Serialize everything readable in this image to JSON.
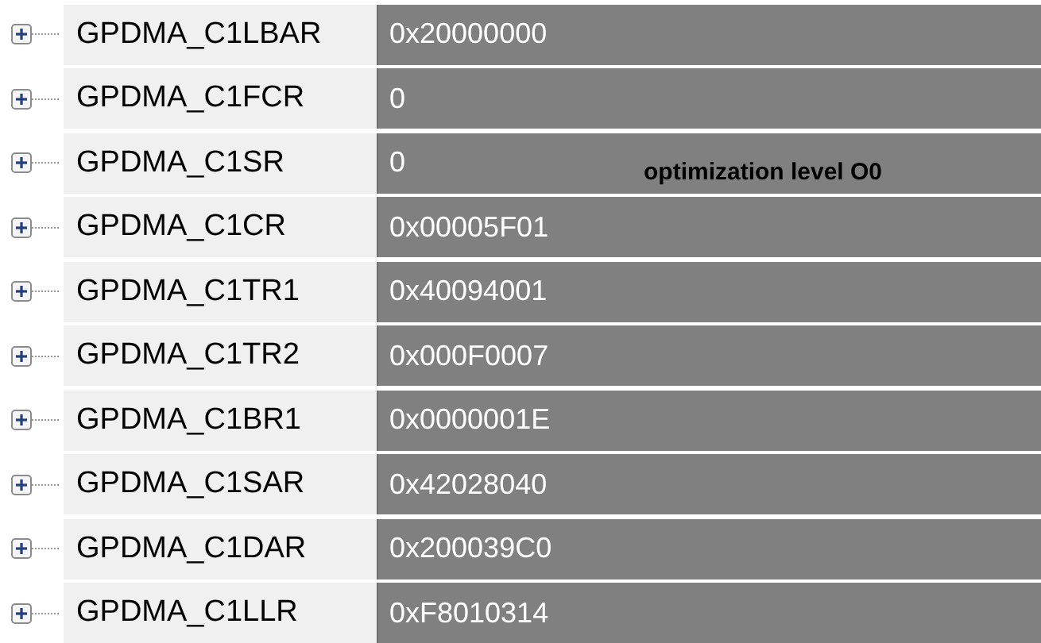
{
  "registers": [
    {
      "name": "GPDMA_C1LBAR",
      "value": "0x20000000",
      "expanded": false
    },
    {
      "name": "GPDMA_C1FCR",
      "value": "0",
      "expanded": false
    },
    {
      "name": "GPDMA_C1SR",
      "value": "0",
      "expanded": false
    },
    {
      "name": "GPDMA_C1CR",
      "value": "0x00005F01",
      "expanded": false
    },
    {
      "name": "GPDMA_C1TR1",
      "value": "0x40094001",
      "expanded": false
    },
    {
      "name": "GPDMA_C1TR2",
      "value": "0x000F0007",
      "expanded": false
    },
    {
      "name": "GPDMA_C1BR1",
      "value": "0x0000001E",
      "expanded": false
    },
    {
      "name": "GPDMA_C1SAR",
      "value": "0x42028040",
      "expanded": false
    },
    {
      "name": "GPDMA_C1DAR",
      "value": "0x200039C0",
      "expanded": false
    },
    {
      "name": "GPDMA_C1LLR",
      "value": "0xF8010314",
      "expanded": false
    }
  ],
  "annotation": "optimization level O0"
}
